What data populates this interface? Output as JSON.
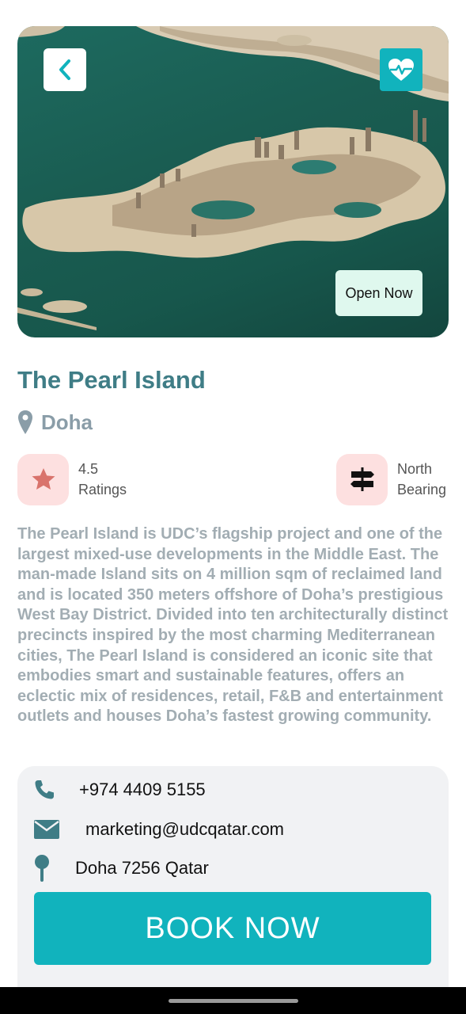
{
  "hero": {
    "open_label": "Open Now",
    "back_icon": "chevron-left-icon",
    "favorite_icon": "heart-pulse-icon"
  },
  "place": {
    "title": "The Pearl Island",
    "location": "Doha"
  },
  "stats": {
    "rating_value": "4.5",
    "rating_label": "Ratings",
    "bearing_value": "North",
    "bearing_label": "Bearing"
  },
  "description": "The Pearl Island is UDC’s flagship project and one of the largest mixed-use developments in the Middle East. The man-made Island sits on 4 million sqm of reclaimed land and is located 350 meters offshore of Doha’s prestigious West Bay District. Divided into ten architecturally distinct precincts inspired by the most charming Mediterranean cities, The Pearl Island is considered an iconic site that embodies smart and sustainable features, offers an eclectic mix of residences, retail, F&B and entertainment outlets and houses Doha’s fastest growing community.",
  "contact": {
    "phone": "+974 4409 5155",
    "email": "marketing@udcqatar.com",
    "address": "Doha 7256 Qatar"
  },
  "book_label": "BOOK NOW",
  "colors": {
    "accent": "#11b3bd",
    "title": "#3f7d86",
    "muted": "#a2adb3",
    "badge_bg": "#fde0e0"
  }
}
